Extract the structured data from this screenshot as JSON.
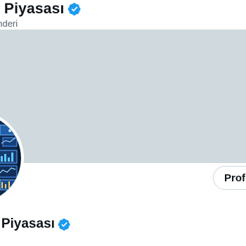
{
  "header": {
    "name": "Borsa Gündemi - Hisse Senedi - Hey Piyasası",
    "name_visible": "y Piyasası",
    "subtitle": "önderi"
  },
  "profile_button": {
    "label": "Profi"
  },
  "profile": {
    "name": "y Piyasası",
    "handle_fragment": "",
    "verified_icon": "verified-badge-icon"
  },
  "colors": {
    "banner": "#cfd9de",
    "verified": "#1d9bf0",
    "text_primary": "#0f1419",
    "text_secondary": "#536471"
  }
}
